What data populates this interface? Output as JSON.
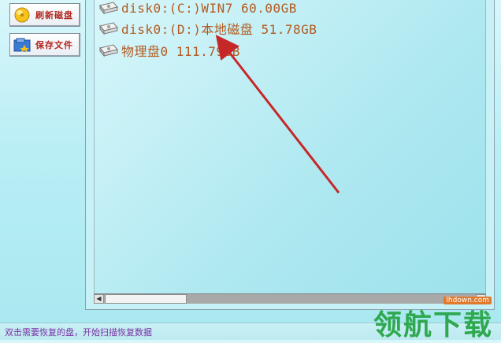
{
  "sidebar": {
    "refresh_label": "刷新磁盘",
    "save_label": "保存文件"
  },
  "disk_list": {
    "items": [
      {
        "text": "disk0:(C:)WIN7 60.00GB",
        "icon": "hard-disk-icon"
      },
      {
        "text": "disk0:(D:)本地磁盘 51.78GB",
        "icon": "hard-disk-icon"
      },
      {
        "text": "物理盘0 111.79GB",
        "icon": "hard-disk-icon"
      }
    ]
  },
  "status": {
    "text": "双击需要恢复的盘，开始扫描恢复数据"
  },
  "watermark": {
    "url": "lhdown.com",
    "name": "领航下载"
  },
  "colors": {
    "item_text": "#b35a1f",
    "status_text": "#7a2fa3",
    "arrow": "#c62828",
    "accent_label": "#b3261e"
  }
}
